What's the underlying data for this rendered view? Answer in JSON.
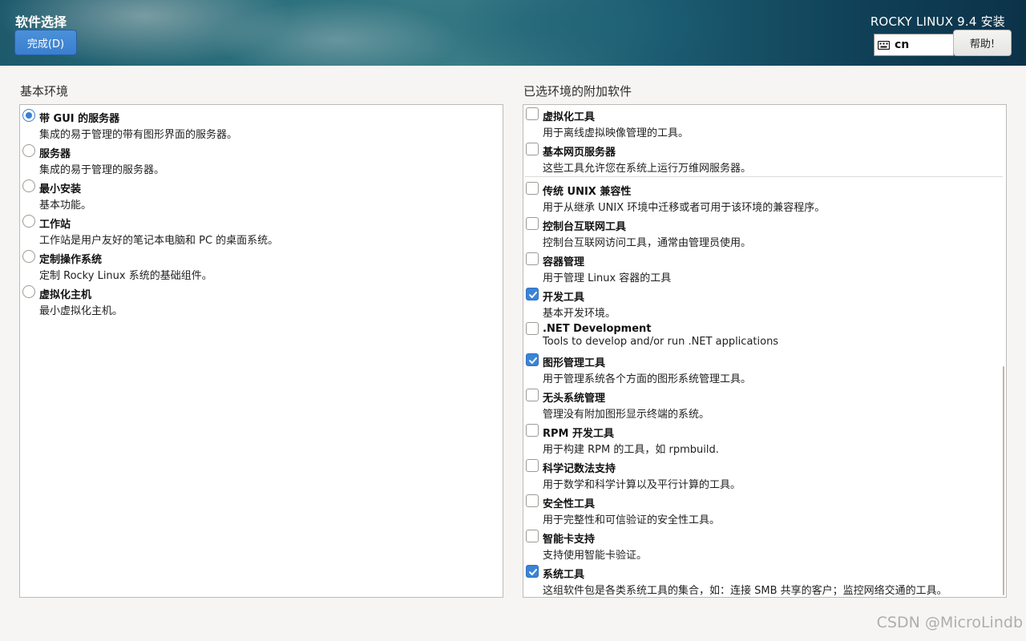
{
  "header": {
    "page_title": "软件选择",
    "done_label": "完成(D)",
    "product_title": "ROCKY LINUX 9.4 安装",
    "keyboard_layout": "cn",
    "keyboard_icon": "keyboard-icon",
    "help_label": "帮助!"
  },
  "base_environment": {
    "label": "基本环境",
    "items": [
      {
        "title": "带 GUI 的服务器",
        "desc": "集成的易于管理的带有图形界面的服务器。",
        "selected": true
      },
      {
        "title": "服务器",
        "desc": "集成的易于管理的服务器。",
        "selected": false
      },
      {
        "title": "最小安装",
        "desc": "基本功能。",
        "selected": false
      },
      {
        "title": "工作站",
        "desc": "工作站是用户友好的笔记本电脑和 PC 的桌面系统。",
        "selected": false
      },
      {
        "title": "定制操作系统",
        "desc": "定制 Rocky Linux 系统的基础组件。",
        "selected": false
      },
      {
        "title": "虚拟化主机",
        "desc": "最小虚拟化主机。",
        "selected": false
      }
    ]
  },
  "addons": {
    "label": "已选环境的附加软件",
    "items": [
      {
        "title": "虚拟化工具",
        "desc": "用于离线虚拟映像管理的工具。",
        "checked": false
      },
      {
        "title": "基本网页服务器",
        "desc": "这些工具允许您在系统上运行万维网服务器。",
        "checked": false
      },
      {
        "title": "传统 UNIX 兼容性",
        "desc": "用于从继承 UNIX 环境中迁移或者可用于该环境的兼容程序。",
        "checked": false
      },
      {
        "title": "控制台互联网工具",
        "desc": "控制台互联网访问工具，通常由管理员使用。",
        "checked": false
      },
      {
        "title": "容器管理",
        "desc": "用于管理 Linux 容器的工具",
        "checked": false
      },
      {
        "title": "开发工具",
        "desc": "基本开发环境。",
        "checked": true
      },
      {
        "title": ".NET Development",
        "desc": "Tools to develop and/or run .NET applications",
        "checked": false
      },
      {
        "title": "图形管理工具",
        "desc": "用于管理系统各个方面的图形系统管理工具。",
        "checked": true
      },
      {
        "title": "无头系统管理",
        "desc": "管理没有附加图形显示终端的系统。",
        "checked": false
      },
      {
        "title": "RPM 开发工具",
        "desc": "用于构建 RPM 的工具，如 rpmbuild.",
        "checked": false
      },
      {
        "title": "科学记数法支持",
        "desc": "用于数学和科学计算以及平行计算的工具。",
        "checked": false
      },
      {
        "title": "安全性工具",
        "desc": "用于完整性和可信验证的安全性工具。",
        "checked": false
      },
      {
        "title": "智能卡支持",
        "desc": "支持使用智能卡验证。",
        "checked": false
      },
      {
        "title": "系统工具",
        "desc": "这组软件包是各类系统工具的集合，如：连接 SMB 共享的客户；监控网络交通的工具。",
        "checked": true
      }
    ]
  },
  "watermark": "CSDN @MicroLindb"
}
